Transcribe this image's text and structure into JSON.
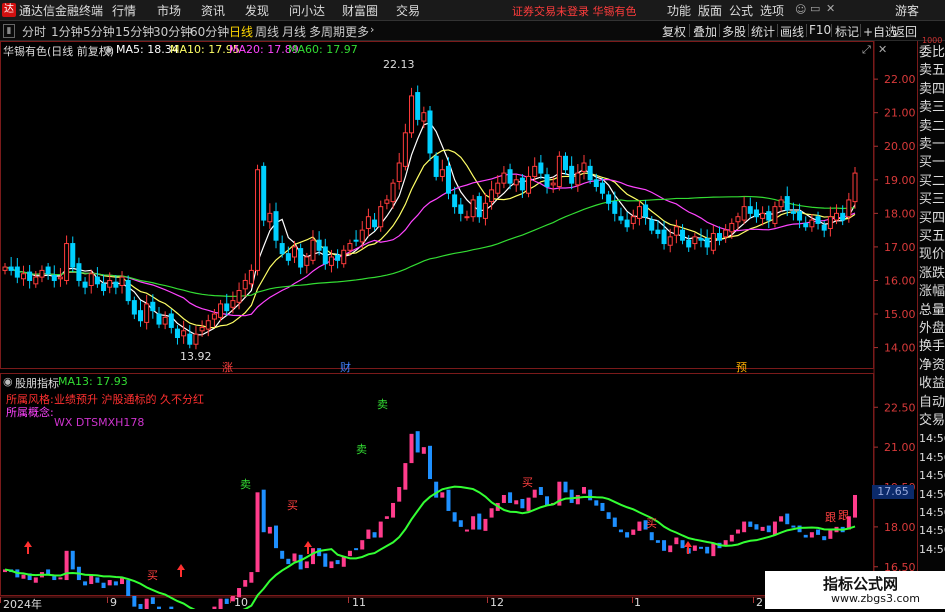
{
  "menubar": {
    "logo": "达",
    "app_name": "通达信金融终端",
    "items": [
      "行情",
      "市场",
      "资讯",
      "发现",
      "问小达",
      "财富圈",
      "交易"
    ],
    "alert": "证券交易未登录   华锡有色",
    "right_items": [
      "功能",
      "版面",
      "公式",
      "选项"
    ],
    "guest": "游客"
  },
  "toolbar": {
    "periods": [
      "分时",
      "1分钟",
      "5分钟",
      "15分钟",
      "30分钟",
      "60分钟",
      "日线",
      "周线",
      "月线",
      "多周期",
      "更多"
    ],
    "active_index": 6,
    "right_items": [
      "复权",
      "叠加",
      "多股",
      "统计",
      "画线",
      "F10",
      "标记",
      "+自选",
      "返回"
    ]
  },
  "main_chart": {
    "title": "华锡有色(日线 前复权)",
    "ma_labels": [
      {
        "text": "MA5: 18.34",
        "color": "#ffffff"
      },
      {
        "text": "MA10: 17.95",
        "color": "#ffff66"
      },
      {
        "text": "MA20: 17.89",
        "color": "#ff44ff"
      },
      {
        "text": "MA60: 17.97",
        "color": "#33dd33"
      }
    ],
    "high_label": "22.13",
    "low_label": "13.92",
    "markers": [
      {
        "text": "涨",
        "color": "#ff4040"
      },
      {
        "text": "财",
        "color": "#4080ff"
      },
      {
        "text": "预",
        "color": "#ffb000"
      }
    ]
  },
  "sub_chart": {
    "title": "股朋指标",
    "ma_label": "MA13: 17.93",
    "style_label": "所属风格:",
    "style_value": "业绩预升 沪股通标的 久不分红",
    "concept_label": "所属概念:",
    "concept_value": "WX  DTSMXH178",
    "current_value": "17.65",
    "sell_mark": "卖",
    "buy_mark": "买",
    "follow_mark": "跟"
  },
  "right_panel": [
    "委比",
    "卖五",
    "卖四",
    "卖三",
    "卖二",
    "卖一",
    "买一",
    "买二",
    "买三",
    "买四",
    "买五",
    "现价",
    "涨跌",
    "涨幅",
    "总量",
    "外盘",
    "换手",
    "净资",
    "收益",
    "自动",
    "交易",
    "14:56",
    "14:56",
    "14:56",
    "14:56",
    "14:56",
    "14:56",
    "14:56"
  ],
  "right_panel_top": "1000",
  "x_axis": [
    "2024年",
    "9",
    "10",
    "11",
    "12",
    "1",
    "2"
  ],
  "watermark": {
    "line1": "指标公式网",
    "line2": "www.zbgs3.com"
  },
  "chart_data": {
    "type": "candlestick",
    "title": "华锡有色(日线 前复权)",
    "price_axis": {
      "ticks": [
        22.0,
        21.0,
        20.0,
        19.0,
        18.0,
        17.0,
        16.0,
        15.0,
        14.0
      ],
      "ylim": [
        13.6,
        22.6
      ]
    },
    "sub_axis": {
      "ticks": [
        22.5,
        21.0,
        19.5,
        18.0,
        16.5
      ],
      "ylim": [
        15.4,
        23.3
      ]
    },
    "series": [
      {
        "name": "MA5",
        "value": 18.34,
        "color": "#ffffff"
      },
      {
        "name": "MA10",
        "value": 17.95,
        "color": "#ffff66"
      },
      {
        "name": "MA20",
        "value": 17.89,
        "color": "#ff44ff"
      },
      {
        "name": "MA60",
        "value": 17.97,
        "color": "#33dd33"
      },
      {
        "name": "MA13",
        "value": 17.93,
        "color": "#33dd33"
      }
    ],
    "high": 22.13,
    "low": 13.92,
    "closes": [
      16.4,
      16.3,
      16.1,
      16.2,
      16.0,
      16.1,
      16.3,
      16.2,
      16.0,
      16.1,
      17.1,
      16.4,
      16.0,
      15.8,
      16.2,
      15.9,
      15.7,
      16.0,
      15.8,
      16.1,
      15.4,
      15.0,
      14.8,
      15.3,
      15.1,
      14.7,
      14.9,
      14.6,
      14.3,
      14.5,
      14.1,
      14.4,
      14.6,
      14.8,
      15.0,
      15.3,
      15.1,
      15.4,
      15.7,
      16.0,
      16.3,
      19.3,
      17.8,
      18.0,
      17.2,
      16.8,
      16.6,
      17.0,
      16.4,
      16.7,
      17.2,
      16.9,
      16.5,
      16.7,
      16.6,
      16.9,
      17.1,
      17.2,
      17.5,
      17.9,
      17.6,
      18.2,
      18.4,
      18.9,
      19.5,
      20.4,
      21.5,
      20.8,
      21.0,
      19.8,
      19.1,
      19.3,
      18.6,
      18.2,
      18.0,
      17.9,
      18.4,
      17.9,
      18.3,
      18.7,
      18.9,
      19.2,
      18.9,
      19.0,
      18.7,
      19.1,
      19.4,
      19.2,
      18.8,
      18.9,
      19.7,
      19.3,
      18.9,
      19.2,
      19.5,
      19.0,
      18.8,
      18.6,
      18.3,
      18.0,
      17.8,
      17.6,
      17.9,
      18.2,
      17.9,
      17.5,
      17.4,
      17.1,
      17.3,
      17.6,
      17.2,
      17.0,
      17.3,
      17.2,
      17.0,
      17.4,
      17.2,
      17.5,
      17.7,
      17.9,
      18.2,
      18.0,
      17.9,
      18.0,
      17.8,
      18.2,
      18.4,
      18.1,
      18.0,
      17.8,
      17.6,
      17.8,
      17.7,
      17.5,
      17.9,
      18.0,
      17.8,
      18.4,
      19.2
    ]
  }
}
